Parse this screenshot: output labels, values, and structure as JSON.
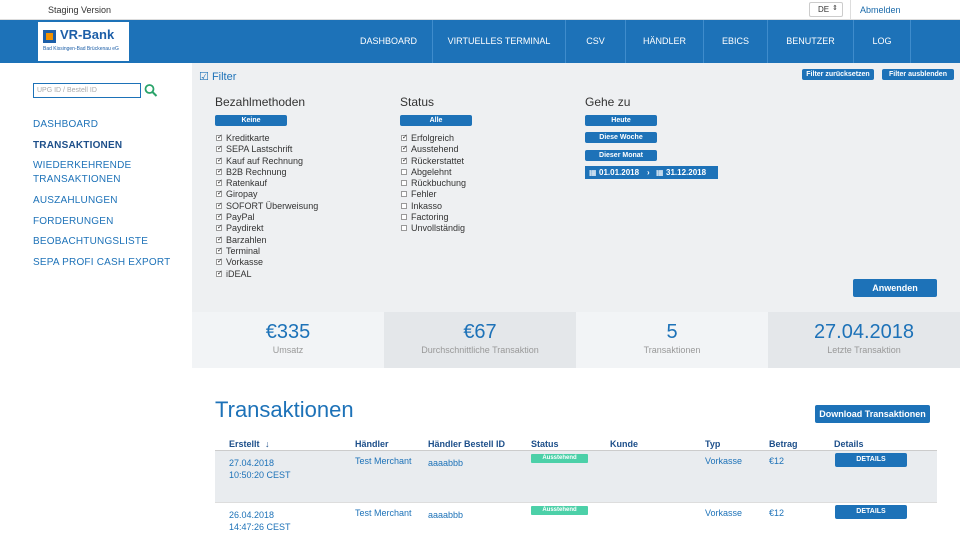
{
  "topbar": {
    "staging": "Staging Version",
    "lang": "DE",
    "logout": "Abmelden"
  },
  "brand": {
    "name": "VR-Bank",
    "sub": "Bad Kissingen-Bad Brückenau eG"
  },
  "nav": [
    "DASHBOARD",
    "VIRTUELLES TERMINAL",
    "CSV",
    "HÄNDLER",
    "EBICS",
    "BENUTZER",
    "LOG"
  ],
  "sidebar": {
    "search_placeholder": "UPG ID / Bestell ID",
    "items": [
      "DASHBOARD",
      "TRANSAKTIONEN",
      "WIEDERKEHRENDE\nTRANSAKTIONEN",
      "AUSZAHLUNGEN",
      "FORDERUNGEN",
      "BEOBACHTUNGSLISTE",
      "SEPA PROFI CASH EXPORT"
    ],
    "active": "TRANSAKTIONEN"
  },
  "filter": {
    "title": "Filter",
    "reset": "Filter zurücksetzen",
    "hide": "Filter ausblenden",
    "payment": {
      "heading": "Bezahlmethoden",
      "button": "Keine",
      "options": [
        {
          "label": "Kreditkarte",
          "checked": true
        },
        {
          "label": "SEPA Lastschrift",
          "checked": true
        },
        {
          "label": "Kauf auf Rechnung",
          "checked": true
        },
        {
          "label": "B2B Rechnung",
          "checked": true
        },
        {
          "label": "Ratenkauf",
          "checked": true
        },
        {
          "label": "Giropay",
          "checked": true
        },
        {
          "label": "SOFORT Überweisung",
          "checked": true
        },
        {
          "label": "PayPal",
          "checked": true
        },
        {
          "label": "Paydirekt",
          "checked": true
        },
        {
          "label": "Barzahlen",
          "checked": true
        },
        {
          "label": "Terminal",
          "checked": true
        },
        {
          "label": "Vorkasse",
          "checked": true
        },
        {
          "label": "iDEAL",
          "checked": true
        }
      ]
    },
    "status": {
      "heading": "Status",
      "button": "Alle",
      "options": [
        {
          "label": "Erfolgreich",
          "checked": true
        },
        {
          "label": "Ausstehend",
          "checked": true
        },
        {
          "label": "Rückerstattet",
          "checked": true
        },
        {
          "label": "Abgelehnt",
          "checked": false
        },
        {
          "label": "Rückbuchung",
          "checked": false
        },
        {
          "label": "Fehler",
          "checked": false
        },
        {
          "label": "Inkasso",
          "checked": false
        },
        {
          "label": "Factoring",
          "checked": false
        },
        {
          "label": "Unvollständig",
          "checked": false
        }
      ]
    },
    "goto": {
      "heading": "Gehe zu",
      "today": "Heute",
      "week": "Diese Woche",
      "month": "Dieser Monat",
      "from": "01.01.2018",
      "to": "31.12.2018"
    },
    "apply": "Anwenden"
  },
  "stats": [
    {
      "value": "€335",
      "label": "Umsatz"
    },
    {
      "value": "€67",
      "label": "Durchschnittliche Transaktion"
    },
    {
      "value": "5",
      "label": "Transaktionen"
    },
    {
      "value": "27.04.2018",
      "label": "Letzte Transaktion"
    }
  ],
  "transactions": {
    "title": "Transaktionen",
    "download": "Download Transaktionen",
    "columns": [
      "Erstellt",
      "Händler",
      "Händler Bestell ID",
      "Status",
      "Kunde",
      "Typ",
      "Betrag",
      "Details"
    ],
    "rows": [
      {
        "date": "27.04.2018",
        "time": "10:50:20 CEST",
        "merchant": "Test Merchant",
        "order": "aaaabbb",
        "status": "Ausstehend",
        "customer": "",
        "type": "Vorkasse",
        "amount": "€12",
        "details": "DETAILS"
      },
      {
        "date": "26.04.2018",
        "time": "14:47:26 CEST",
        "merchant": "Test Merchant",
        "order": "aaaabbb",
        "status": "Ausstehend",
        "customer": "",
        "type": "Vorkasse",
        "amount": "€12",
        "details": "DETAILS"
      }
    ]
  },
  "colors": {
    "primary": "#1d72b8",
    "badge": "#4cd0a8",
    "filter_bg": "#eef0f2"
  }
}
